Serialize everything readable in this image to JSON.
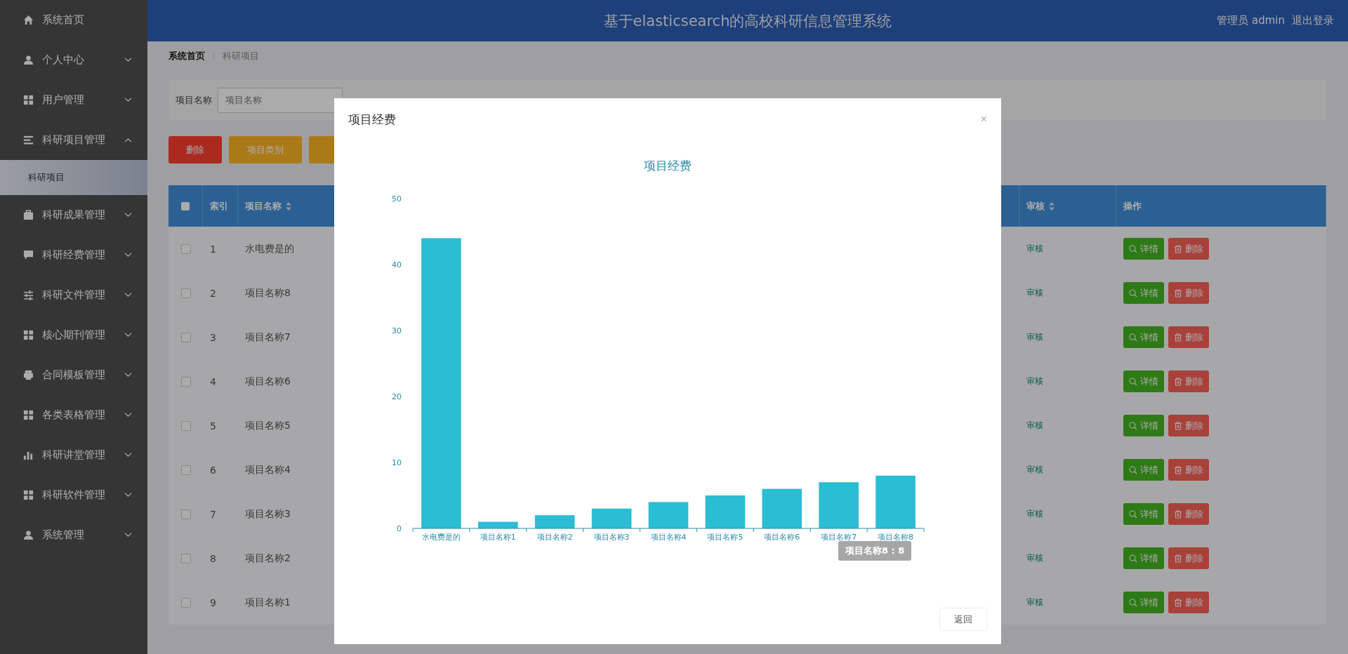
{
  "sidebar": {
    "items": [
      {
        "label": "系统首页",
        "has_children": false
      },
      {
        "label": "个人中心",
        "expanded": false,
        "has_children": true
      },
      {
        "label": "用户管理",
        "expanded": false,
        "has_children": true
      },
      {
        "label": "科研项目管理",
        "expanded": true,
        "has_children": true,
        "children": [
          {
            "label": "科研项目",
            "selected": true
          }
        ]
      },
      {
        "label": "科研成果管理",
        "expanded": false,
        "has_children": true
      },
      {
        "label": "科研经费管理",
        "expanded": false,
        "has_children": true
      },
      {
        "label": "科研文件管理",
        "expanded": false,
        "has_children": true
      },
      {
        "label": "核心期刊管理",
        "expanded": false,
        "has_children": true
      },
      {
        "label": "合同模板管理",
        "expanded": false,
        "has_children": true
      },
      {
        "label": "各类表格管理",
        "expanded": false,
        "has_children": true
      },
      {
        "label": "科研讲堂管理",
        "expanded": false,
        "has_children": true
      },
      {
        "label": "科研软件管理",
        "expanded": false,
        "has_children": true
      },
      {
        "label": "系统管理",
        "expanded": false,
        "has_children": true
      }
    ]
  },
  "header": {
    "title": "基于elasticsearch的高校科研信息管理系统",
    "user": "管理员 admin",
    "logout": "退出登录"
  },
  "breadcrumb": [
    "系统首页",
    "科研项目"
  ],
  "filter": {
    "label": "项目名称",
    "placeholder": "项目名称"
  },
  "actions": [
    {
      "label": "删除",
      "kind": "danger"
    },
    {
      "label": "项目类别",
      "kind": "warning"
    }
  ],
  "table": {
    "all_checked": false,
    "columns": [
      {
        "label": "索引",
        "sortable": false
      },
      {
        "label": "项目名称",
        "sortable": true
      },
      {
        "label": "审核",
        "sortable": true
      },
      {
        "label": "操作",
        "sortable": false
      }
    ],
    "rows": [
      {
        "index": "1",
        "name": "水电费是的",
        "review": "审核",
        "checked": false,
        "buttons": [
          {
            "label": "详情",
            "kind": "detail"
          },
          {
            "label": "删除",
            "kind": "delete"
          }
        ]
      },
      {
        "index": "2",
        "name": "项目名称8",
        "review": "审核",
        "checked": false,
        "buttons": [
          {
            "label": "详情",
            "kind": "detail"
          },
          {
            "label": "删除",
            "kind": "delete"
          }
        ]
      },
      {
        "index": "3",
        "name": "项目名称7",
        "review": "审核",
        "checked": false,
        "buttons": [
          {
            "label": "详情",
            "kind": "detail"
          },
          {
            "label": "删除",
            "kind": "delete"
          }
        ]
      },
      {
        "index": "4",
        "name": "项目名称6",
        "review": "审核",
        "checked": false,
        "buttons": [
          {
            "label": "详情",
            "kind": "detail"
          },
          {
            "label": "删除",
            "kind": "delete"
          }
        ]
      },
      {
        "index": "5",
        "name": "项目名称5",
        "review": "审核",
        "checked": false,
        "buttons": [
          {
            "label": "详情",
            "kind": "detail"
          },
          {
            "label": "删除",
            "kind": "delete"
          }
        ]
      },
      {
        "index": "6",
        "name": "项目名称4",
        "review": "审核",
        "checked": false,
        "buttons": [
          {
            "label": "详情",
            "kind": "detail"
          },
          {
            "label": "删除",
            "kind": "delete"
          }
        ]
      },
      {
        "index": "7",
        "name": "项目名称3",
        "review": "审核",
        "checked": false,
        "buttons": [
          {
            "label": "详情",
            "kind": "detail"
          },
          {
            "label": "删除",
            "kind": "delete"
          }
        ]
      },
      {
        "index": "8",
        "name": "项目名称2",
        "review": "审核",
        "checked": false,
        "buttons": [
          {
            "label": "详情",
            "kind": "detail"
          },
          {
            "label": "删除",
            "kind": "delete"
          }
        ]
      },
      {
        "index": "9",
        "name": "项目名称1",
        "review": "审核",
        "checked": false,
        "buttons": [
          {
            "label": "详情",
            "kind": "detail"
          },
          {
            "label": "删除",
            "kind": "delete"
          }
        ]
      }
    ]
  },
  "modal": {
    "title": "项目经费",
    "close": "×",
    "footer_button": "返回",
    "chart_data": {
      "type": "bar",
      "title": "项目经费",
      "categories": [
        "水电费是的",
        "项目名称1",
        "项目名称2",
        "项目名称3",
        "项目名称4",
        "项目名称5",
        "项目名称6",
        "项目名称7",
        "项目名称8"
      ],
      "series": [
        {
          "color": "#2bbdd3",
          "values": [
            44,
            1,
            2,
            3,
            4,
            5,
            6,
            7,
            8
          ]
        }
      ],
      "ylim": [
        0,
        50
      ],
      "yticks": [
        0,
        10,
        20,
        30,
        40,
        50
      ]
    },
    "tooltip": "项目名称8 : 8"
  }
}
